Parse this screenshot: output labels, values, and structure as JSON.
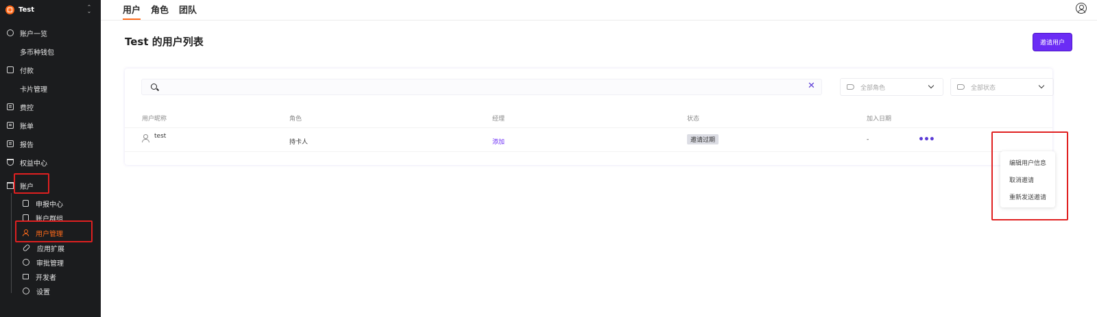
{
  "workspace": {
    "name": "Test",
    "toggle_up": "⌃",
    "toggle_down": "⌄"
  },
  "sidebar": {
    "items": [
      {
        "label": "账户一览",
        "icon": "dashboard-icon"
      },
      {
        "label": "多币种钱包",
        "icon": "wallet-icon"
      },
      {
        "label": "付款",
        "icon": "payment-icon"
      },
      {
        "label": "卡片管理",
        "icon": "card-icon"
      },
      {
        "label": "费控",
        "icon": "expense-icon"
      },
      {
        "label": "账单",
        "icon": "bill-icon"
      },
      {
        "label": "报告",
        "icon": "report-icon"
      },
      {
        "label": "权益中心",
        "icon": "trophy-icon"
      },
      {
        "label": "账户",
        "icon": "store-icon"
      }
    ],
    "sub_items": [
      {
        "label": "申报中心",
        "icon": "doc-icon"
      },
      {
        "label": "账户群组",
        "icon": "group-icon"
      },
      {
        "label": "用户管理",
        "icon": "user-icon",
        "active": true
      },
      {
        "label": "应用扩展",
        "icon": "link-icon"
      },
      {
        "label": "审批管理",
        "icon": "check-circle-icon"
      },
      {
        "label": "开发者",
        "icon": "monitor-icon"
      },
      {
        "label": "设置",
        "icon": "gear-icon"
      }
    ]
  },
  "topnav": {
    "tabs": [
      "用户",
      "角色",
      "团队"
    ],
    "active": "用户"
  },
  "main": {
    "title": "Test 的用户列表",
    "invite_label": "邀请用户",
    "search": {
      "value": "",
      "clear_icon": "✕"
    },
    "role_filter": "全部角色",
    "status_filter": "全部状态",
    "columns": [
      "用户昵称",
      "角色",
      "经理",
      "状态",
      "加入日期"
    ],
    "row": {
      "name": "test",
      "role": "持卡人",
      "manager": "添加",
      "status": "邀请过期",
      "join_date": "-"
    },
    "more_label": "•••",
    "menu": [
      "编辑用户信息",
      "取消邀请",
      "重新发送邀请"
    ]
  },
  "colors": {
    "accent": "#ff6a1a",
    "primary": "#6b2cf5",
    "sidebar": "#1b1c1e",
    "highlight": "#e02020"
  }
}
